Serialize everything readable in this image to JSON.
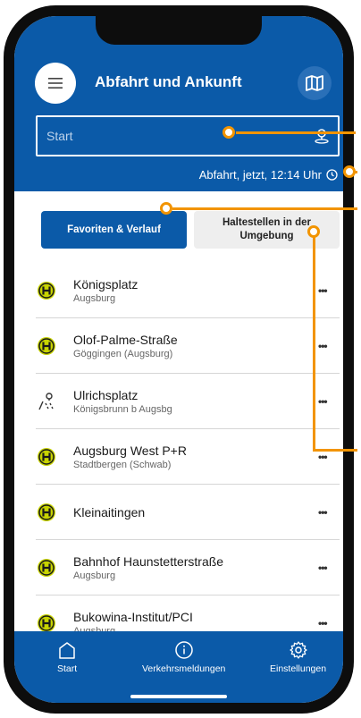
{
  "header": {
    "title": "Abfahrt und Ankunft",
    "menu_icon": "hamburger-menu-icon",
    "map_icon": "map-icon"
  },
  "search": {
    "placeholder": "Start",
    "location_icon": "location-pin-icon"
  },
  "departure": {
    "label": "Abfahrt, jetzt, 12:14 Uhr",
    "icon": "clock-icon"
  },
  "tabs": {
    "favorites": "Favoriten & Verlauf",
    "nearby": "Haltestellen in der Umgebung"
  },
  "stops": [
    {
      "name": "Königsplatz",
      "area": "Augsburg",
      "icon": "bus-stop-icon"
    },
    {
      "name": "Olof-Palme-Straße",
      "area": "Göggingen (Augsburg)",
      "icon": "bus-stop-icon"
    },
    {
      "name": "Ulrichsplatz",
      "area": "Königsbrunn b Augsbg",
      "icon": "location-route-icon"
    },
    {
      "name": "Augsburg West P+R",
      "area": "Stadtbergen (Schwab)",
      "icon": "bus-stop-icon"
    },
    {
      "name": "Kleinaitingen",
      "area": "",
      "icon": "bus-stop-icon"
    },
    {
      "name": "Bahnhof Haunstetterstraße",
      "area": "Augsburg",
      "icon": "bus-stop-icon"
    },
    {
      "name": "Bukowina-Institut/PCI",
      "area": "Augsburg",
      "icon": "bus-stop-icon"
    }
  ],
  "more_label": "•••",
  "nav": {
    "start": "Start",
    "news": "Verkehrsmeldungen",
    "settings": "Einstellungen"
  },
  "colors": {
    "brand": "#0b5aa8",
    "stop_badge": "#c8d400",
    "annotation": "#f29400"
  }
}
